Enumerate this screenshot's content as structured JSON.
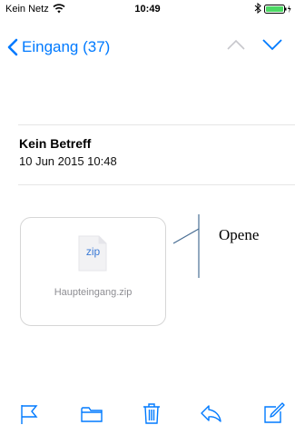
{
  "status_bar": {
    "carrier": "Kein Netz",
    "time": "10:49",
    "icons": [
      "wifi-icon",
      "bluetooth-icon",
      "battery-icon"
    ]
  },
  "nav_bar": {
    "back_label": "Eingang (37)",
    "icons": [
      "chevron-left-icon",
      "chevron-up-icon",
      "chevron-down-icon"
    ]
  },
  "message": {
    "subject": "Kein Betreff",
    "date": "10 Jun 2015 10:48"
  },
  "attachment": {
    "type_label": "zip",
    "file_name": "Haupteingang.zip"
  },
  "overlay": {
    "text": "Opene"
  },
  "toolbar": {
    "icons": [
      "flag-icon",
      "folder-icon",
      "trash-icon",
      "reply-icon",
      "compose-icon"
    ]
  },
  "colors": {
    "accent": "#007aff",
    "battery": "#4cd964",
    "divider": "#e6e6e6",
    "secondary_text": "#8e8e93"
  }
}
